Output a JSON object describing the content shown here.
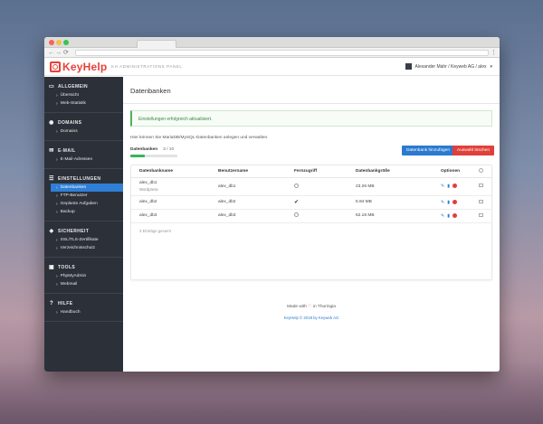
{
  "app": {
    "logo_text": "KeyHelp",
    "panel_name": "KH ADMINISTRATIONS PANEL",
    "user_label": "Alexander Mahr / Keyweb AG / alex"
  },
  "sidebar": {
    "sections": [
      {
        "label": "ALLGEMEIN",
        "icon": "monitor-icon",
        "items": [
          {
            "label": "Übersicht"
          },
          {
            "label": "Web-Statistik"
          }
        ]
      },
      {
        "label": "DOMAINS",
        "icon": "globe-icon",
        "items": [
          {
            "label": "Domains"
          }
        ]
      },
      {
        "label": "E-MAIL",
        "icon": "envelope-icon",
        "items": [
          {
            "label": "E-Mail-Adressen"
          }
        ]
      },
      {
        "label": "EINSTELLUNGEN",
        "icon": "sliders-icon",
        "items": [
          {
            "label": "Datenbanken",
            "active": true
          },
          {
            "label": "FTP-Benutzer"
          },
          {
            "label": "Geplante Aufgaben"
          },
          {
            "label": "Backup"
          }
        ]
      },
      {
        "label": "SICHERHEIT",
        "icon": "shield-icon",
        "items": [
          {
            "label": "SSL/TLS-Zertifikate"
          },
          {
            "label": "Verzeichnisschutz"
          }
        ]
      },
      {
        "label": "TOOLS",
        "icon": "briefcase-icon",
        "items": [
          {
            "label": "PhpMyAdmin"
          },
          {
            "label": "Webmail"
          }
        ]
      },
      {
        "label": "HILFE",
        "icon": "question-icon",
        "items": [
          {
            "label": "Handbuch"
          }
        ]
      }
    ]
  },
  "main": {
    "title": "Datenbanken",
    "alert": "Einstellungen erfolgreich aktualisiert.",
    "intro": "Hier können Sie MariaDB/MySQL-Datenbanken anlegen und verwalten.",
    "quota_label": "Datenbanken",
    "quota_count": "3 / 10",
    "quota_fraction": 0.3,
    "btn_add": "Datenbank hinzufügen",
    "btn_delete": "Auswahl löschen",
    "table": {
      "headers": [
        "Datenbankname",
        "Benutzername",
        "Fernzugriff",
        "Datenbankgröße",
        "Optionen"
      ],
      "rows": [
        {
          "name": "alex_db1",
          "sub": "Wordpress",
          "user": "alex_db1",
          "remote": false,
          "size": "23.26 MB"
        },
        {
          "name": "alex_db2",
          "sub": "",
          "user": "alex_db2",
          "remote": true,
          "size": "5.94 MB"
        },
        {
          "name": "alex_db3",
          "sub": "",
          "user": "alex_db3",
          "remote": false,
          "size": "62.18 MB"
        }
      ],
      "footer": "3 Einträge gesamt"
    }
  },
  "footer": {
    "made_prefix": "Made with",
    "made_suffix": "in Thuringia",
    "copyright": "KeyHelp © 2018 by Keyweb AG"
  }
}
